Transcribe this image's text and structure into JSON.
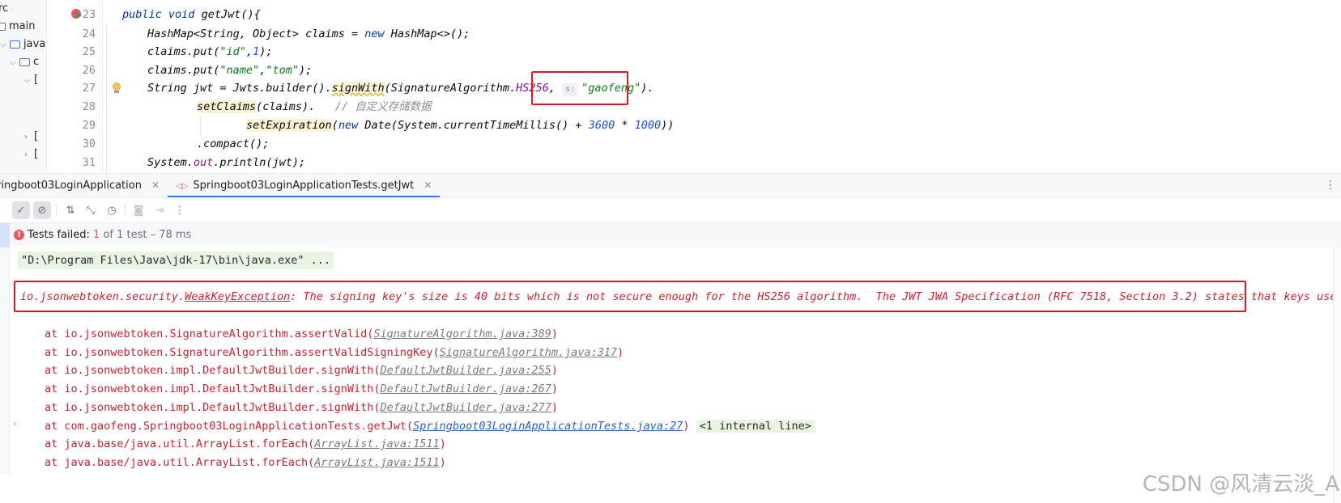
{
  "project_tree": {
    "items": [
      {
        "label": "rc"
      },
      {
        "label": "main"
      },
      {
        "label": "java"
      },
      {
        "label": "c"
      },
      {
        "label": "["
      },
      {
        "label": "["
      },
      {
        "label": "["
      }
    ]
  },
  "editor": {
    "line_numbers": [
      "23",
      "24",
      "25",
      "26",
      "27",
      "28",
      "29",
      "30",
      "31"
    ],
    "lines": {
      "l23": {
        "kw1": "public",
        "kw2": "void",
        "rest": " getJwt(){"
      },
      "l24": {
        "a": "HashMap<String, Object> claims = ",
        "kw": "new",
        "b": " HashMap<>();"
      },
      "l25": {
        "a": "claims.put(",
        "s": "\"id\"",
        "b": ",",
        "n": "1",
        "c": ");"
      },
      "l26": {
        "a": "claims.put(",
        "s1": "\"name\"",
        "b": ",",
        "s2": "\"tom\"",
        "c": ");"
      },
      "l27": {
        "a": "String jwt = Jwts.builder().",
        "m": "signWith",
        "b": "(SignatureAlgorithm.",
        "f": "HS256",
        "c": ", ",
        "hint": "s:",
        "s": "\"gaofeng\"",
        "d": ")."
      },
      "l28": {
        "m": "setClaims",
        "a": "(claims).   ",
        "cmt": "// 自定义存储数据"
      },
      "l29": {
        "m": "setExpiration",
        "a": "(",
        "kw": "new",
        "b": " Date(System.currentTimeMillis() + ",
        "n1": "3600",
        "c": " * ",
        "n2": "1000",
        "d": "))"
      },
      "l30": {
        "a": ".compact();"
      },
      "l31": {
        "a": "System.",
        "f": "out",
        "b": ".println(jwt);"
      }
    }
  },
  "run_tabs": [
    {
      "label": "ringboot03LoginApplication",
      "active": false
    },
    {
      "label": "Springboot03LoginApplicationTests.getJwt",
      "active": true
    }
  ],
  "toolbar": {
    "icons": [
      "check-icon",
      "stop-icon",
      "sort-icon",
      "collapse-icon",
      "history-icon",
      "camera-icon",
      "import-icon",
      "more-icon"
    ]
  },
  "status": {
    "prefix": "Tests failed: ",
    "failed": "1",
    "suffix": " of 1 test – 78 ms"
  },
  "console": {
    "cmdline": "\"D:\\Program Files\\Java\\jdk-17\\bin\\java.exe\" ...",
    "exception": {
      "pkg": "io.jsonwebtoken.security.",
      "cls": "WeakKeyException",
      "msg": ": The signing key's size is 40 bits which is not secure enough for the HS256 algorithm.  The JWT JWA Specification (RFC 7518, Section 3.2) states that keys used wi"
    },
    "stack": [
      {
        "at": "at io.jsonwebtoken.SignatureAlgorithm.assertValid(",
        "link": "SignatureAlgorithm.java:389",
        "end": ")"
      },
      {
        "at": "at io.jsonwebtoken.SignatureAlgorithm.assertValidSigningKey(",
        "link": "SignatureAlgorithm.java:317",
        "end": ")"
      },
      {
        "at": "at io.jsonwebtoken.impl.DefaultJwtBuilder.signWith(",
        "link": "DefaultJwtBuilder.java:255",
        "end": ")"
      },
      {
        "at": "at io.jsonwebtoken.impl.DefaultJwtBuilder.signWith(",
        "link": "DefaultJwtBuilder.java:267",
        "end": ")"
      },
      {
        "at": "at io.jsonwebtoken.impl.DefaultJwtBuilder.signWith(",
        "link": "DefaultJwtBuilder.java:277",
        "end": ")"
      },
      {
        "at": "at com.gaofeng.Springboot03LoginApplicationTests.getJwt(",
        "link": "Springboot03LoginApplicationTests.java:27",
        "end": ")",
        "internal": "<1 internal line>"
      },
      {
        "at": "at java.base/java.util.ArrayList.forEach(",
        "link": "ArrayList.java:1511",
        "end": ")"
      },
      {
        "at": "at java.base/java.util.ArrayList.forEach(",
        "link": "ArrayList.java:1511",
        "end": ")"
      }
    ]
  },
  "watermark": "CSDN @风清云淡_A",
  "colors": {
    "accent": "#3574f0",
    "error": "#e55765",
    "highlight_box": "#e4161c",
    "keyword": "#0033b3",
    "string": "#067d17",
    "number": "#1750eb"
  }
}
